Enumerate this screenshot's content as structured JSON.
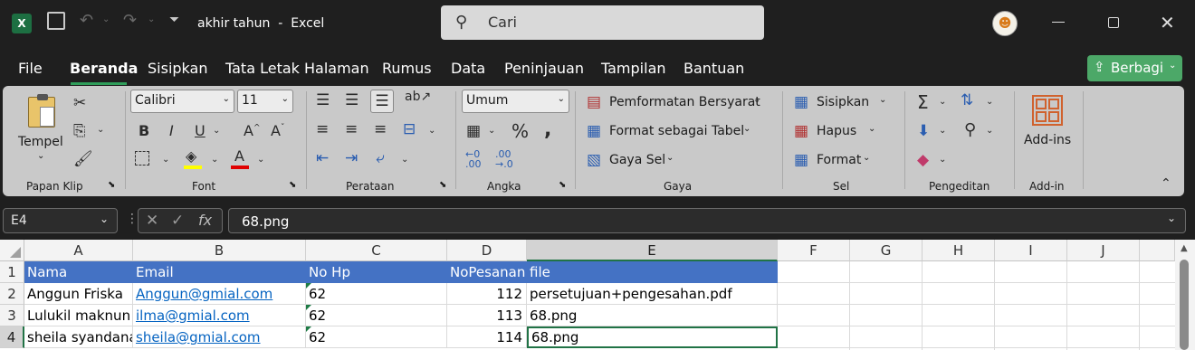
{
  "window": {
    "title": "akhir tahun  -  Excel",
    "search_placeholder": "Cari",
    "share_label": "Berbagi"
  },
  "menu_tabs": [
    "File",
    "Beranda",
    "Sisipkan",
    "Tata Letak Halaman",
    "Rumus",
    "Data",
    "Peninjauan",
    "Tampilan",
    "Bantuan"
  ],
  "active_tab": "Beranda",
  "ribbon": {
    "clipboard": {
      "paste_label": "Tempel",
      "group_label": "Papan Klip"
    },
    "font": {
      "font_name": "Calibri",
      "font_size": "11",
      "group_label": "Font"
    },
    "alignment": {
      "group_label": "Perataan"
    },
    "number": {
      "format": "Umum",
      "group_label": "Angka"
    },
    "styles": {
      "conditional": "Pemformatan Bersyarat",
      "as_table": "Format sebagai Tabel",
      "cell_styles": "Gaya Sel",
      "group_label": "Gaya"
    },
    "cells": {
      "insert": "Sisipkan",
      "delete": "Hapus",
      "format": "Format",
      "group_label": "Sel"
    },
    "editing": {
      "group_label": "Pengeditan"
    },
    "addins": {
      "label": "Add-ins",
      "group_label": "Add-in"
    }
  },
  "formula_bar": {
    "name_box": "E4",
    "formula": "68.png"
  },
  "sheet": {
    "columns": [
      "A",
      "B",
      "C",
      "D",
      "E",
      "F",
      "G",
      "H",
      "I",
      "J"
    ],
    "selected_column": "E",
    "rows": [
      "1",
      "2",
      "3",
      "4"
    ],
    "selected_row": "4",
    "header": [
      "Nama",
      "Email",
      "No Hp",
      "NoPesanan",
      "file"
    ],
    "data": [
      [
        "Anggun Friska",
        "Anggun@gmial.com",
        "62",
        "112",
        "persetujuan+pengesahan.pdf"
      ],
      [
        "Lulukil maknun",
        "ilma@gmial.com",
        "62",
        "113",
        "68.png"
      ],
      [
        "sheila syandana",
        "sheila@gmial.com",
        "62",
        "114",
        "68.png"
      ]
    ]
  },
  "colors": {
    "accent": "#217346",
    "table_header": "#4472c4",
    "share": "#4ca868"
  }
}
